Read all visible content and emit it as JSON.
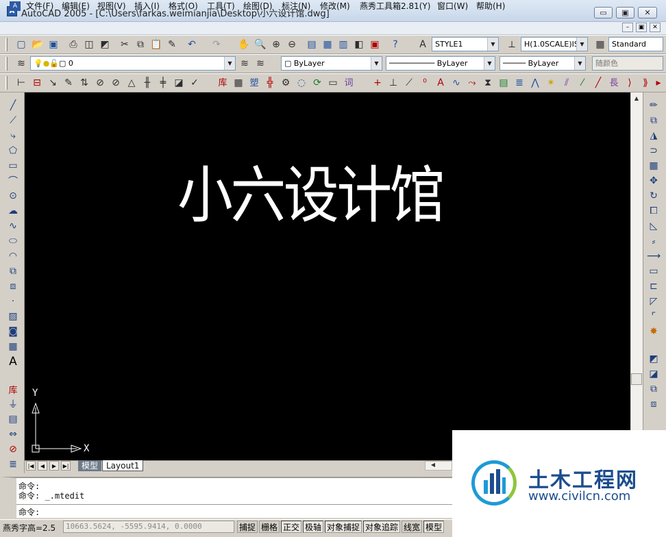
{
  "window": {
    "title": "AutoCAD 2005 - [C:\\Users\\farkas.weimianjia\\Desktop\\小六设计馆.dwg]",
    "app_icon_glyph": "A",
    "min_glyph": "▭",
    "max_glyph": "▣",
    "close_glyph": "✕"
  },
  "menu": {
    "items": [
      "文件(F)",
      "编辑(E)",
      "视图(V)",
      "插入(I)",
      "格式(O)",
      "工具(T)",
      "绘图(D)",
      "标注(N)",
      "修改(M)",
      "燕秀工具箱2.81(Y)",
      "窗口(W)",
      "帮助(H)"
    ],
    "mdi_min": "–",
    "mdi_restore": "▣",
    "mdi_close": "✕"
  },
  "toolbar": {
    "text_style": "STYLE1",
    "dim_style": "H(1.0SCALE)IS",
    "table_style": "Standard",
    "layer": "0",
    "color": "ByLayer",
    "linetype": "ByLayer",
    "lineweight": "ByLayer",
    "plot_style": "随颜色"
  },
  "canvas": {
    "drawing_text": "小六设计馆",
    "ucs_x": "X",
    "ucs_y": "Y"
  },
  "tabs": {
    "model": "模型",
    "layout1": "Layout1"
  },
  "command": {
    "line1": "命令:",
    "line2": "命令:  _.mtedit",
    "prompt": "命令:"
  },
  "status": {
    "text_height_label": "燕秀字高=2.5",
    "coordinates": "10663.5624,  -5595.9414,  0.0000",
    "buttons": [
      "捕捉",
      "栅格",
      "正交",
      "极轴",
      "对象捕捉",
      "对象追踪",
      "线宽",
      "模型"
    ]
  },
  "watermark": {
    "title": "土木工程网",
    "url": "www.civilcn.com"
  },
  "colors": {
    "canvas_background": "#000000",
    "drawing_text": "#ffffff",
    "watermark_blue": "#1b4d8e",
    "watermark_green": "#8cc63f"
  }
}
